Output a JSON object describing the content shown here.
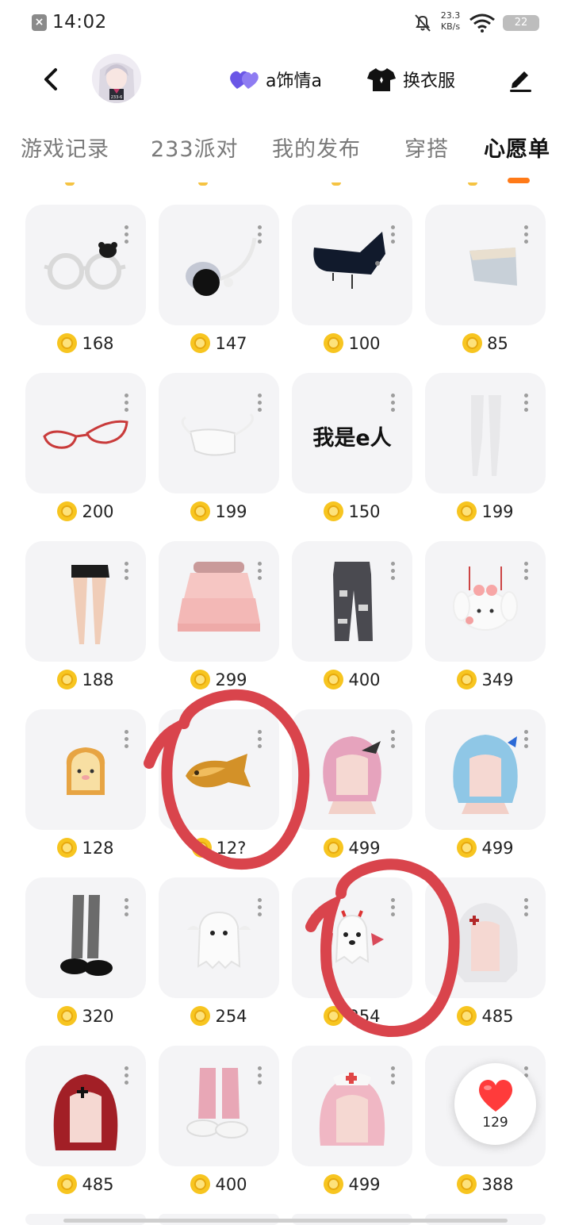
{
  "status_bar": {
    "time": "14:02",
    "net_speed_value": "23.3",
    "net_speed_unit": "KB/s",
    "battery": "22"
  },
  "header": {
    "status_label": "a饰情a",
    "outfit_label": "换衣服",
    "avatar_caption": "233-6"
  },
  "tabs": [
    {
      "label": "游戏记录"
    },
    {
      "label": "233派对"
    },
    {
      "label": "我的发布"
    },
    {
      "label": "穿搭"
    },
    {
      "label": "心愿单"
    }
  ],
  "items": [
    {
      "name": "white-glasses-icon",
      "price": "168"
    },
    {
      "name": "flower-earring-icon",
      "price": "147"
    },
    {
      "name": "black-eyepatch-icon",
      "price": "100"
    },
    {
      "name": "visor-icon",
      "price": "85"
    },
    {
      "name": "red-glasses-icon",
      "price": "200"
    },
    {
      "name": "white-mask-icon",
      "price": "199"
    },
    {
      "name": "text-sticker",
      "price": "150",
      "text": "我是e人"
    },
    {
      "name": "white-stockings-icon",
      "price": "199"
    },
    {
      "name": "black-shorts-icon",
      "price": "188"
    },
    {
      "name": "pink-skirt-icon",
      "price": "299"
    },
    {
      "name": "ripped-jeans-icon",
      "price": "400"
    },
    {
      "name": "bunny-backpack-icon",
      "price": "349"
    },
    {
      "name": "toast-icon",
      "price": "128"
    },
    {
      "name": "taiyaki-icon",
      "price": "12?"
    },
    {
      "name": "pink-hair-icon",
      "price": "499"
    },
    {
      "name": "blue-hair-icon",
      "price": "499"
    },
    {
      "name": "leg-warmers-boots-icon",
      "price": "320"
    },
    {
      "name": "ghost-pet-icon",
      "price": "254"
    },
    {
      "name": "devil-ghost-icon",
      "price": "254"
    },
    {
      "name": "white-hair-icon",
      "price": "485"
    },
    {
      "name": "red-hair-icon",
      "price": "485"
    },
    {
      "name": "pink-boots-icon",
      "price": "400"
    },
    {
      "name": "nurse-hair-icon",
      "price": "499"
    },
    {
      "name": "doll-icon",
      "price": "388"
    }
  ],
  "fab": {
    "count": "129"
  },
  "colors": {
    "accent": "#ff7a18",
    "coin": "#f7c520",
    "heart": "#ff3b3b",
    "scribble": "#d9444c",
    "status_heart": "#6a56e6"
  }
}
